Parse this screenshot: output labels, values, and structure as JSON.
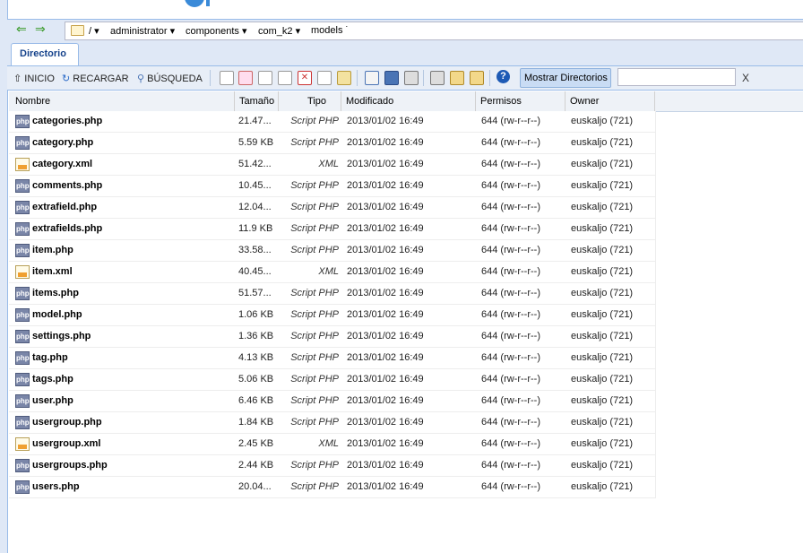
{
  "nav": {
    "path": [
      {
        "label": "/",
        "has_menu": true
      },
      {
        "label": "administrator",
        "has_menu": true
      },
      {
        "label": "components",
        "has_menu": true
      },
      {
        "label": "com_k2",
        "has_menu": true
      },
      {
        "label": "models",
        "has_menu": true
      }
    ],
    "back_icon": "arrow-left-icon",
    "forward_icon": "arrow-right-icon"
  },
  "tab": {
    "label": "Directorio"
  },
  "toolbar": {
    "home_label": "INICIO",
    "reload_label": "RECARGAR",
    "search_label": "BÚSQUEDA",
    "show_dirs_label": "Mostrar Directorios",
    "filter_value": "",
    "clear_label": "X"
  },
  "columns": [
    "Nombre",
    "Tamaño",
    "Tipo",
    "Modificado",
    "Permisos",
    "Owner"
  ],
  "files": [
    {
      "icon": "php",
      "name": "categories.php",
      "size": "21.47...",
      "type": "Script PHP",
      "modified": "2013/01/02 16:49",
      "perms": "644 (rw-r--r--)",
      "owner": "euskaljo (721)"
    },
    {
      "icon": "php",
      "name": "category.php",
      "size": "5.59 KB",
      "type": "Script PHP",
      "modified": "2013/01/02 16:49",
      "perms": "644 (rw-r--r--)",
      "owner": "euskaljo (721)"
    },
    {
      "icon": "xml",
      "name": "category.xml",
      "size": "51.42...",
      "type": "XML",
      "modified": "2013/01/02 16:49",
      "perms": "644 (rw-r--r--)",
      "owner": "euskaljo (721)"
    },
    {
      "icon": "php",
      "name": "comments.php",
      "size": "10.45...",
      "type": "Script PHP",
      "modified": "2013/01/02 16:49",
      "perms": "644 (rw-r--r--)",
      "owner": "euskaljo (721)"
    },
    {
      "icon": "php",
      "name": "extrafield.php",
      "size": "12.04...",
      "type": "Script PHP",
      "modified": "2013/01/02 16:49",
      "perms": "644 (rw-r--r--)",
      "owner": "euskaljo (721)"
    },
    {
      "icon": "php",
      "name": "extrafields.php",
      "size": "11.9 KB",
      "type": "Script PHP",
      "modified": "2013/01/02 16:49",
      "perms": "644 (rw-r--r--)",
      "owner": "euskaljo (721)"
    },
    {
      "icon": "php",
      "name": "item.php",
      "size": "33.58...",
      "type": "Script PHP",
      "modified": "2013/01/02 16:49",
      "perms": "644 (rw-r--r--)",
      "owner": "euskaljo (721)"
    },
    {
      "icon": "xml",
      "name": "item.xml",
      "size": "40.45...",
      "type": "XML",
      "modified": "2013/01/02 16:49",
      "perms": "644 (rw-r--r--)",
      "owner": "euskaljo (721)"
    },
    {
      "icon": "php",
      "name": "items.php",
      "size": "51.57...",
      "type": "Script PHP",
      "modified": "2013/01/02 16:49",
      "perms": "644 (rw-r--r--)",
      "owner": "euskaljo (721)"
    },
    {
      "icon": "php",
      "name": "model.php",
      "size": "1.06 KB",
      "type": "Script PHP",
      "modified": "2013/01/02 16:49",
      "perms": "644 (rw-r--r--)",
      "owner": "euskaljo (721)"
    },
    {
      "icon": "php",
      "name": "settings.php",
      "size": "1.36 KB",
      "type": "Script PHP",
      "modified": "2013/01/02 16:49",
      "perms": "644 (rw-r--r--)",
      "owner": "euskaljo (721)"
    },
    {
      "icon": "php",
      "name": "tag.php",
      "size": "4.13 KB",
      "type": "Script PHP",
      "modified": "2013/01/02 16:49",
      "perms": "644 (rw-r--r--)",
      "owner": "euskaljo (721)"
    },
    {
      "icon": "php",
      "name": "tags.php",
      "size": "5.06 KB",
      "type": "Script PHP",
      "modified": "2013/01/02 16:49",
      "perms": "644 (rw-r--r--)",
      "owner": "euskaljo (721)"
    },
    {
      "icon": "php",
      "name": "user.php",
      "size": "6.46 KB",
      "type": "Script PHP",
      "modified": "2013/01/02 16:49",
      "perms": "644 (rw-r--r--)",
      "owner": "euskaljo (721)"
    },
    {
      "icon": "php",
      "name": "usergroup.php",
      "size": "1.84 KB",
      "type": "Script PHP",
      "modified": "2013/01/02 16:49",
      "perms": "644 (rw-r--r--)",
      "owner": "euskaljo (721)"
    },
    {
      "icon": "xml",
      "name": "usergroup.xml",
      "size": "2.45 KB",
      "type": "XML",
      "modified": "2013/01/02 16:49",
      "perms": "644 (rw-r--r--)",
      "owner": "euskaljo (721)"
    },
    {
      "icon": "php",
      "name": "usergroups.php",
      "size": "2.44 KB",
      "type": "Script PHP",
      "modified": "2013/01/02 16:49",
      "perms": "644 (rw-r--r--)",
      "owner": "euskaljo (721)"
    },
    {
      "icon": "php",
      "name": "users.php",
      "size": "20.04...",
      "type": "Script PHP",
      "modified": "2013/01/02 16:49",
      "perms": "644 (rw-r--r--)",
      "owner": "euskaljo (721)"
    }
  ],
  "colors": {
    "accent": "#15428b",
    "panel": "#dfe8f6",
    "border": "#99bbe8"
  }
}
